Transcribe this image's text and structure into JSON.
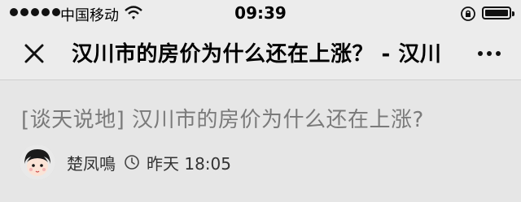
{
  "status_bar": {
    "carrier": "中国移动",
    "time": "09:39"
  },
  "nav": {
    "title": "汉川市的房价为什么还在上涨？ - 汉川"
  },
  "article": {
    "title": "[谈天说地] 汉川市的房价为什么还在上涨?",
    "author": "楚凤鳴",
    "time": "昨天 18:05"
  },
  "icons": {
    "close": "close-icon",
    "more": "more-icon",
    "clock": "clock-icon",
    "wifi": "wifi-icon",
    "lock": "rotation-lock-icon",
    "battery": "battery-icon"
  }
}
